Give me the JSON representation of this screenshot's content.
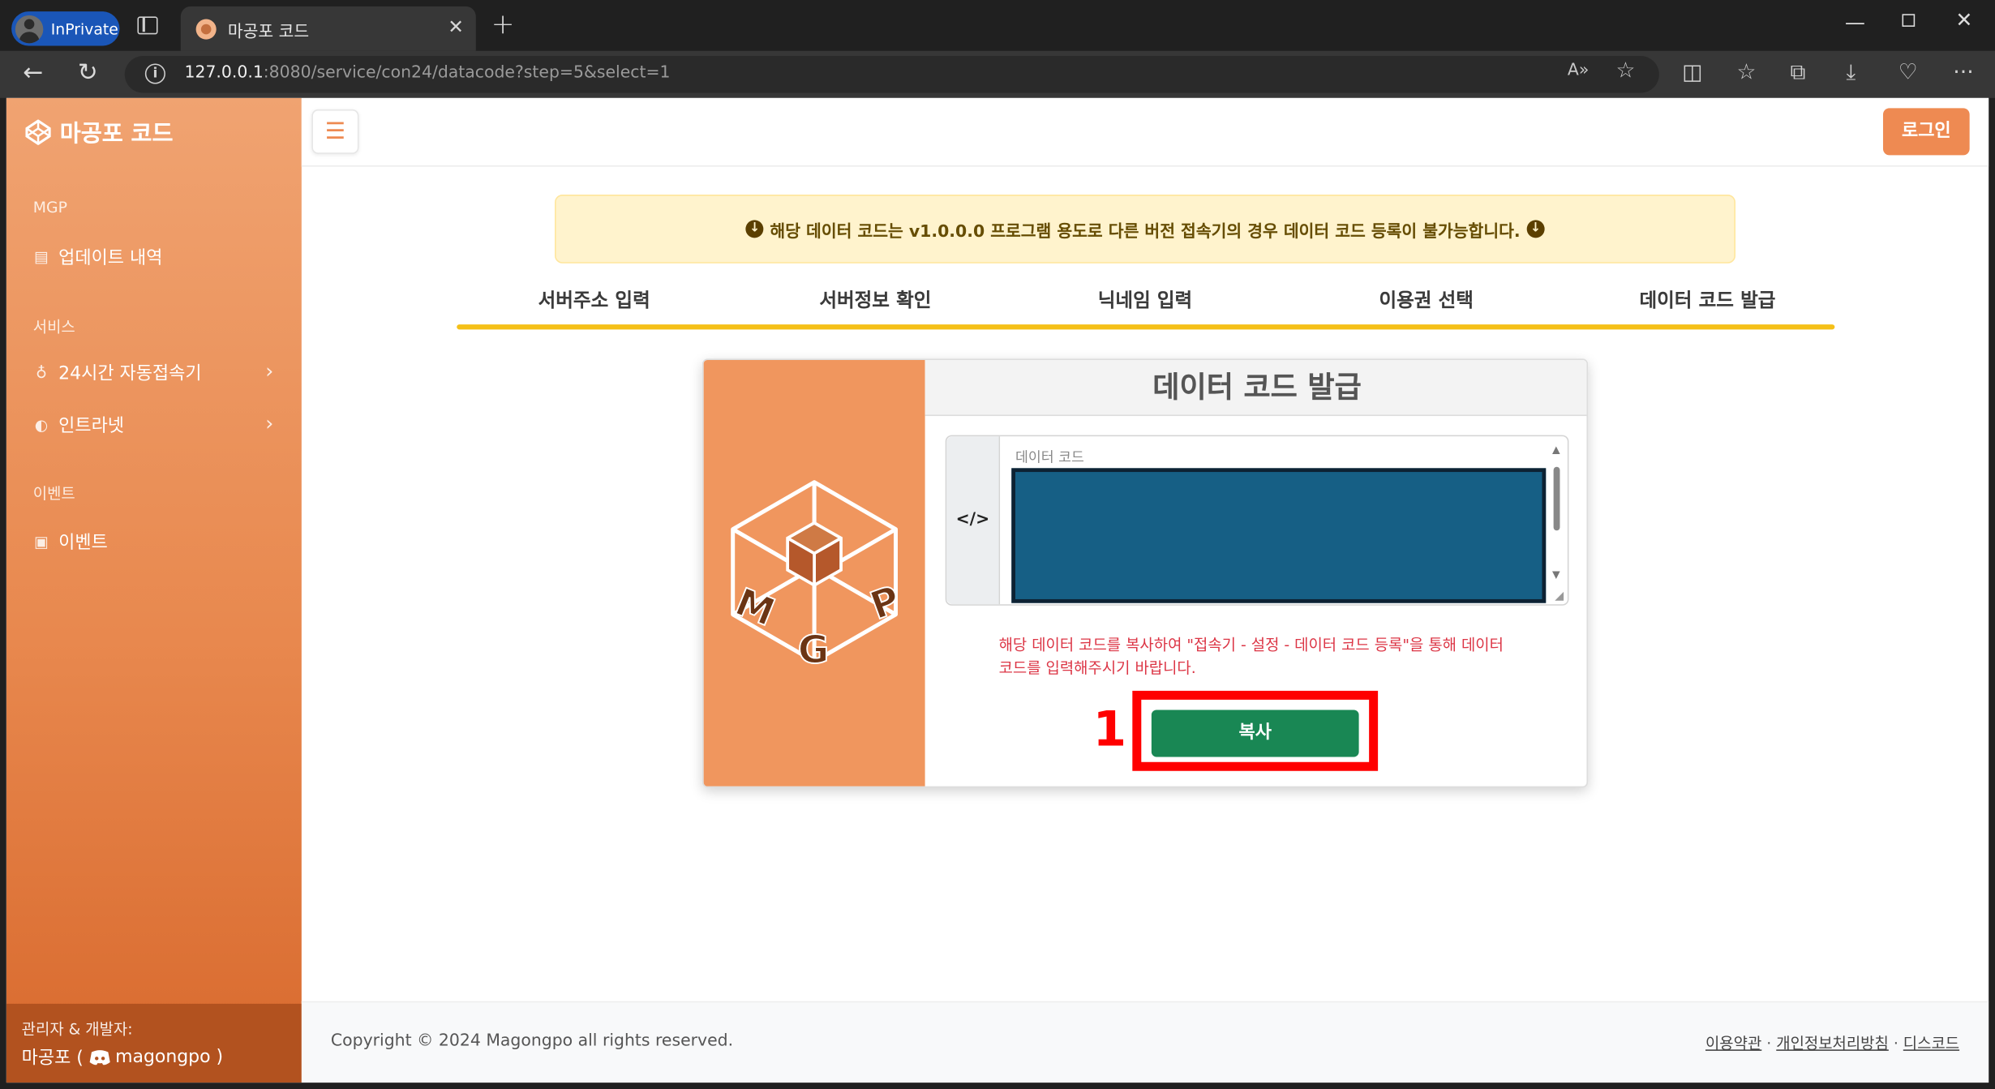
{
  "browser": {
    "inprivate_label": "InPrivate",
    "tab_title": "마공포 코드",
    "tab_close": "✕",
    "new_tab": "+",
    "url_host": "127.0.0.1",
    "url_rest": ":8080/service/con24/datacode?step=5&select=1"
  },
  "sidebar": {
    "brand": "마공포 코드",
    "sections": [
      {
        "heading": "MGP",
        "items": [
          {
            "label": "업데이트 내역",
            "icon": "clipboard-icon"
          }
        ]
      },
      {
        "heading": "서비스",
        "items": [
          {
            "label": "24시간 자동접속기",
            "icon": "lightbulb-icon"
          },
          {
            "label": "인트라넷",
            "icon": "circle-half-icon"
          }
        ]
      },
      {
        "heading": "이벤트",
        "items": [
          {
            "label": "이벤트",
            "icon": "calendar-check-icon"
          }
        ]
      }
    ],
    "footer_line1": "관리자 & 개발자:",
    "footer_name": "마공포 (",
    "footer_handle": "magongpo )"
  },
  "topbar": {
    "menu_icon": "☰",
    "login_label": "로그인"
  },
  "notice": {
    "text": "해당 데이터 코드는 v1.0.0.0 프로그램 용도로 다른 버전 접속기의 경우 데이터 코드 등록이 불가능합니다."
  },
  "steps": [
    "서버주소 입력",
    "서버정보 확인",
    "닉네임 입력",
    "이용권 선택",
    "데이터 코드 발급"
  ],
  "steps_progress": 1.0,
  "card": {
    "title": "데이터 코드 발급",
    "code_addon": "</>",
    "code_label": "데이터 코드",
    "code_value": "",
    "warning_line1": "해당 데이터 코드를 복사하여 \"접속기 - 설정 - 데이터 코드 등록\"을 통해 데이터",
    "warning_line2": "코드를 입력해주시기 바랍니다.",
    "copy_label": "복사",
    "annotation_number": "1"
  },
  "footer": {
    "copyright": "Copyright © 2024 Magongpo all rights reserved.",
    "links": [
      "이용약관",
      "개인정보처리방침",
      "디스코드"
    ],
    "separator": " · "
  },
  "colors": {
    "brand": "#ee8a52",
    "sidebar_footer": "#b2521f",
    "progress": "#f5c018",
    "copy_button": "#198754",
    "annotation": "#ff0000",
    "code_area": "#165f85"
  }
}
